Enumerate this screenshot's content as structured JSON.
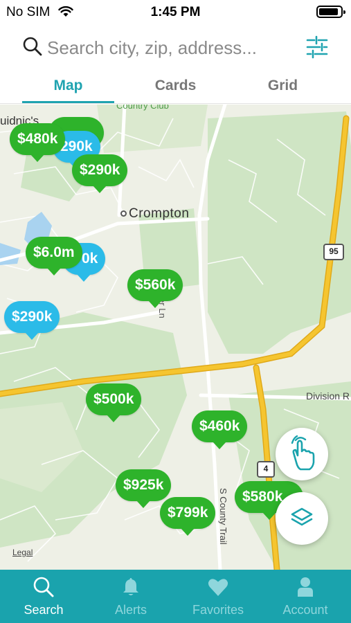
{
  "status_bar": {
    "carrier": "No SIM",
    "time": "1:45 PM",
    "battery_level": 0.9
  },
  "search": {
    "placeholder": "Search city, zip, address...",
    "icon": "search-icon",
    "filter_icon": "sliders-icon"
  },
  "tabs": [
    {
      "label": "Map",
      "active": true
    },
    {
      "label": "Cards",
      "active": false
    },
    {
      "label": "Grid",
      "active": false
    }
  ],
  "map": {
    "labels": {
      "country_club": "Country Club",
      "town": "Crompton",
      "quaker_ln": "Quaker Ln",
      "division_rd": "Division R",
      "s_county_trail": "S County Trail",
      "top_left_partial": "uidnic's",
      "legal": "Legal"
    },
    "route_shields": {
      "interstate": "95",
      "state_route": "4"
    },
    "pins": [
      {
        "label": "290k",
        "color": "blue"
      },
      {
        "label": "$480k",
        "color": "green"
      },
      {
        "label": "$290k",
        "color": "green"
      },
      {
        "label": "0k",
        "color": "blue"
      },
      {
        "label": "$6.0m",
        "color": "green"
      },
      {
        "label": "$560k",
        "color": "green"
      },
      {
        "label": "$290k",
        "color": "blue"
      },
      {
        "label": "$500k",
        "color": "green"
      },
      {
        "label": "$460k",
        "color": "green"
      },
      {
        "label": "$925k",
        "color": "green"
      },
      {
        "label": "$799k",
        "color": "green"
      },
      {
        "label": "$580k",
        "color": "green"
      }
    ],
    "buttons": {
      "draw": "hand-draw-icon",
      "layers": "layers-icon"
    }
  },
  "bottom_nav": [
    {
      "label": "Search",
      "icon": "search-icon",
      "active": true
    },
    {
      "label": "Alerts",
      "icon": "bell-icon",
      "active": false
    },
    {
      "label": "Favorites",
      "icon": "heart-icon",
      "active": false
    },
    {
      "label": "Account",
      "icon": "person-icon",
      "active": false
    }
  ],
  "colors": {
    "accent": "#1fa3b0",
    "nav_background": "#1aa3ad",
    "pin_green": "#2eb32b",
    "pin_blue": "#2bbbe8",
    "highway": "#f5c530"
  }
}
